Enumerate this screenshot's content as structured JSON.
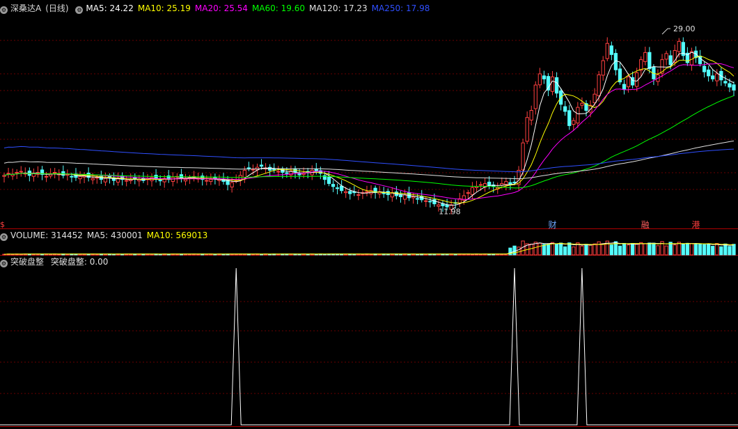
{
  "stock": {
    "title": "深桑达A",
    "period": "(日线)"
  },
  "price_panel": {
    "ma_labels": [
      {
        "text": "MA5: 24.22",
        "color": "#ffffff"
      },
      {
        "text": "MA10: 25.19",
        "color": "#ffff00"
      },
      {
        "text": "MA20: 25.54",
        "color": "#ff00ff"
      },
      {
        "text": "MA60: 19.60",
        "color": "#00ff00"
      },
      {
        "text": "MA120: 17.23",
        "color": "#e0e0e0"
      },
      {
        "text": "MA250: 17.98",
        "color": "#2f4fff"
      }
    ],
    "high_label": "29.00",
    "low_label": "11.98",
    "event_markers": [
      {
        "label": "财",
        "color": "#6ea8ff"
      },
      {
        "label": "融",
        "color": "#ff6060"
      },
      {
        "label": "港",
        "color": "#ff4040"
      }
    ],
    "left_marker": "$"
  },
  "volume_panel": {
    "labels": [
      {
        "text": "VOLUME: 314452",
        "color": "#e0e0e0"
      },
      {
        "text": "MA5: 430001",
        "color": "#e0e0e0"
      },
      {
        "text": "MA10: 569013",
        "color": "#ffff00"
      }
    ]
  },
  "indicator_panel": {
    "name": "突破盘整",
    "labels": [
      {
        "text": "突破盘整: 0.00",
        "color": "#e0e0e0"
      }
    ]
  },
  "chart_data": {
    "type": "line",
    "x": [
      0,
      1,
      2,
      3,
      4,
      5,
      6,
      7,
      8,
      9,
      10,
      11,
      12,
      13,
      14,
      15,
      16,
      17,
      18,
      19,
      20,
      21,
      22,
      23,
      24,
      25,
      26,
      27,
      28,
      29,
      30,
      31,
      32,
      33,
      34,
      35,
      36,
      37,
      38,
      39,
      40,
      41,
      42,
      43,
      44,
      45,
      46,
      47,
      48,
      49,
      50,
      51,
      52,
      53,
      54,
      55,
      56,
      57,
      58,
      59,
      60,
      61,
      62,
      63,
      64,
      65,
      66,
      67,
      68,
      69,
      70,
      71,
      72,
      73,
      74,
      75,
      76,
      77,
      78,
      79,
      80,
      81,
      82,
      83,
      84,
      85,
      86,
      87,
      88,
      89,
      90,
      91,
      92,
      93,
      94,
      95,
      96,
      97,
      98,
      99,
      100,
      101,
      102,
      103,
      104,
      105,
      106,
      107,
      108,
      109,
      110,
      111,
      112,
      113,
      114,
      115,
      116,
      117,
      118,
      119,
      120,
      121,
      122,
      123,
      124,
      125,
      126,
      127,
      128,
      129,
      130,
      131,
      132,
      133,
      134,
      135,
      136,
      137,
      138,
      139,
      140,
      141,
      142,
      143,
      144,
      145,
      146,
      147,
      148,
      149,
      150,
      151,
      152,
      153,
      154,
      155,
      156,
      157,
      158,
      159,
      160,
      161,
      162,
      163,
      164,
      165,
      166,
      167,
      168,
      169,
      170,
      171,
      172,
      173,
      174,
      175
    ],
    "close": [
      15.1,
      15.3,
      15.2,
      15.4,
      15.5,
      15.3,
      15.1,
      15.3,
      15.4,
      15.2,
      15.0,
      15.2,
      15.4,
      15.3,
      15.1,
      15.2,
      15.0,
      14.9,
      15.0,
      15.1,
      14.9,
      14.8,
      14.9,
      14.7,
      14.8,
      14.9,
      14.6,
      14.8,
      14.7,
      14.6,
      14.7,
      14.8,
      14.7,
      14.6,
      14.8,
      14.9,
      14.7,
      14.6,
      14.8,
      14.7,
      14.9,
      15.0,
      14.8,
      14.7,
      14.9,
      15.0,
      14.8,
      14.7,
      14.6,
      14.7,
      14.8,
      14.7,
      14.5,
      14.2,
      14.4,
      14.6,
      15.1,
      15.6,
      15.8,
      15.7,
      15.9,
      16.0,
      15.8,
      15.6,
      15.7,
      15.5,
      15.4,
      15.3,
      15.5,
      15.4,
      15.2,
      15.3,
      15.4,
      15.6,
      15.5,
      15.3,
      14.7,
      14.3,
      14.0,
      13.8,
      13.6,
      13.5,
      13.3,
      13.4,
      13.2,
      13.4,
      13.5,
      13.6,
      13.4,
      13.5,
      13.3,
      13.2,
      13.4,
      13.1,
      13.0,
      13.2,
      12.9,
      13.0,
      12.8,
      12.7,
      12.6,
      12.5,
      12.3,
      12.2,
      12.1,
      12.0,
      12.2,
      12.4,
      12.8,
      13.1,
      13.4,
      13.9,
      14.0,
      14.2,
      14.3,
      14.1,
      14.0,
      13.9,
      14.3,
      14.5,
      14.2,
      14.4,
      15.6,
      18.3,
      20.8,
      21.5,
      24.0,
      25.1,
      24.6,
      23.5,
      24.8,
      23.2,
      22.1,
      21.4,
      20.0,
      20.5,
      21.8,
      22.2,
      21.5,
      22.0,
      23.1,
      25.0,
      26.4,
      28.1,
      27.0,
      25.5,
      24.3,
      23.6,
      24.8,
      24.0,
      25.2,
      26.5,
      27.2,
      25.6,
      24.6,
      25.0,
      26.5,
      27.1,
      26.0,
      27.4,
      28.3,
      26.9,
      26.2,
      27.3,
      26.7,
      26.1,
      25.3,
      24.9,
      24.6,
      25.1,
      24.5,
      24.2,
      23.8,
      23.5
    ],
    "ma_periods": [
      5,
      10,
      20,
      60,
      120,
      250
    ],
    "volume_ma_periods": [
      5,
      10
    ],
    "breakout_signal_x": [
      55,
      121,
      137
    ],
    "low": {
      "x": 107,
      "value": 11.98
    },
    "high": {
      "x": 156,
      "value": 29.0
    },
    "ylim": [
      10.7,
      31.0
    ]
  }
}
